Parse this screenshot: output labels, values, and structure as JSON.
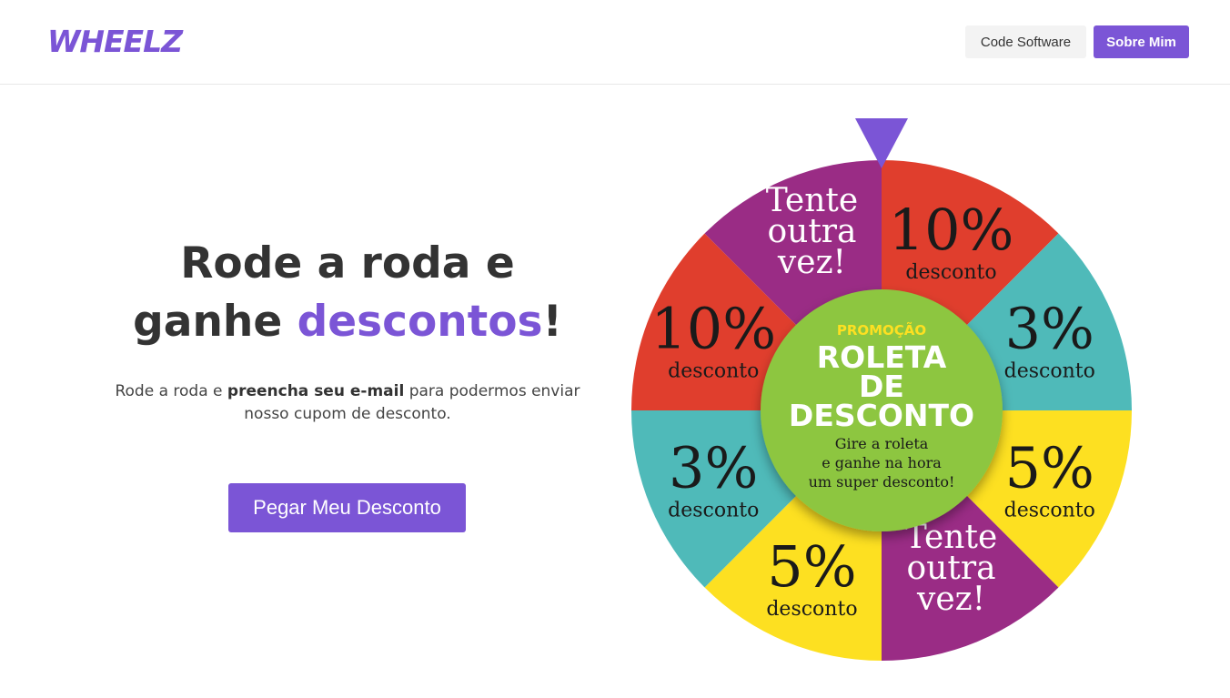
{
  "nav": {
    "logo": "WHEELZ",
    "code_software": "Code Software",
    "sobre_mim": "Sobre Mim"
  },
  "hero": {
    "title_line1": "Rode a roda e",
    "title_line2_prefix": "ganhe ",
    "title_highlight": "descontos",
    "title_suffix": "!",
    "text_part1": "Rode a roda e ",
    "text_bold": "preencha seu e-mail",
    "text_part2": " para podermos enviar nosso cupom de desconto.",
    "cta": "Pegar Meu Desconto"
  },
  "wheel": {
    "center": {
      "promo": "PROMOÇÃO",
      "title1": "ROLETA",
      "title2": "DE",
      "title3": "DESCONTO",
      "sub1": "Gire a roleta",
      "sub2": "e ganhe na hora",
      "sub3": "um super desconto!"
    },
    "segments": [
      {
        "big": "10%",
        "small": "desconto",
        "color": "#e03e2d"
      },
      {
        "big": "3%",
        "small": "desconto",
        "color": "#4fbab9"
      },
      {
        "big": "5%",
        "small": "desconto",
        "color": "#fde021"
      },
      {
        "lines": [
          "Tente",
          "outra",
          "vez!"
        ],
        "color": "#9a2c85"
      },
      {
        "big": "5%",
        "small": "desconto",
        "color": "#fde021"
      },
      {
        "big": "3%",
        "small": "desconto",
        "color": "#4fbab9"
      },
      {
        "big": "10%",
        "small": "desconto",
        "color": "#e03e2d"
      },
      {
        "lines": [
          "Tente",
          "outra",
          "vez!"
        ],
        "color": "#9a2c85"
      }
    ],
    "pointer_color": "#7b55d6",
    "center_color": "#8dc63f"
  }
}
